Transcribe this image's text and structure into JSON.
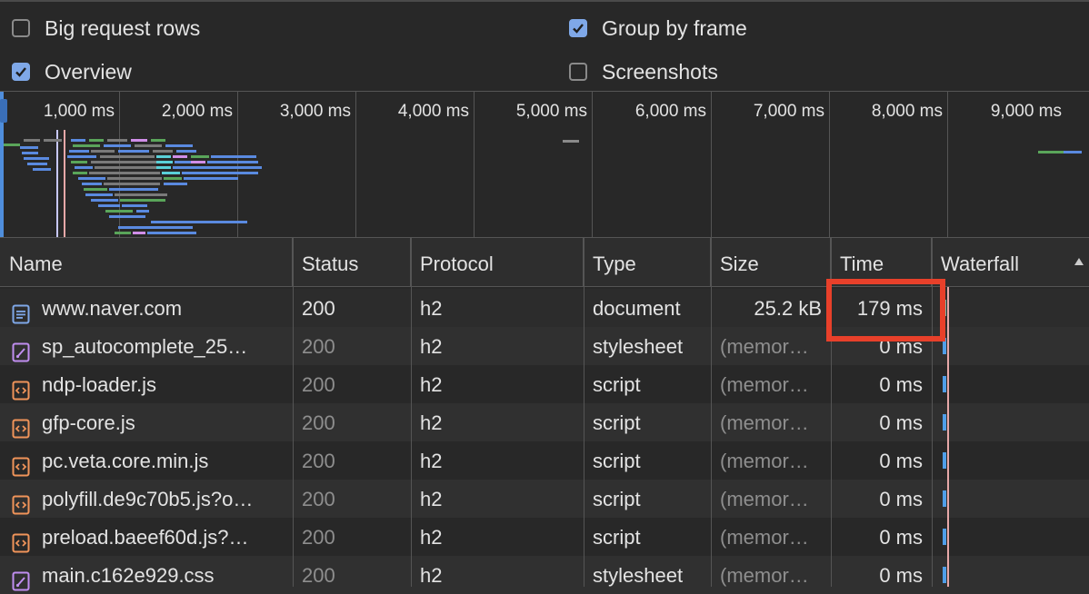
{
  "settings": {
    "big_request_rows": {
      "label": "Big request rows",
      "checked": false
    },
    "overview": {
      "label": "Overview",
      "checked": true
    },
    "group_by_frame": {
      "label": "Group by frame",
      "checked": true
    },
    "screenshots": {
      "label": "Screenshots",
      "checked": false
    }
  },
  "overview": {
    "ticks": [
      "1,000 ms",
      "2,000 ms",
      "3,000 ms",
      "4,000 ms",
      "5,000 ms",
      "6,000 ms",
      "7,000 ms",
      "8,000 ms",
      "9,000 ms"
    ]
  },
  "table": {
    "headers": {
      "name": "Name",
      "status": "Status",
      "protocol": "Protocol",
      "type": "Type",
      "size": "Size",
      "time": "Time",
      "waterfall": "Waterfall"
    },
    "rows": [
      {
        "icon": "document-icon",
        "name": "www.naver.com",
        "status": "200",
        "protocol": "h2",
        "type": "document",
        "size": "25.2 kB",
        "time": "179 ms"
      },
      {
        "icon": "stylesheet-icon",
        "name": "sp_autocomplete_25…",
        "status": "200",
        "protocol": "h2",
        "type": "stylesheet",
        "size": "(memor…",
        "time": "0 ms"
      },
      {
        "icon": "script-icon",
        "name": "ndp-loader.js",
        "status": "200",
        "protocol": "h2",
        "type": "script",
        "size": "(memor…",
        "time": "0 ms"
      },
      {
        "icon": "script-icon",
        "name": "gfp-core.js",
        "status": "200",
        "protocol": "h2",
        "type": "script",
        "size": "(memor…",
        "time": "0 ms"
      },
      {
        "icon": "script-icon",
        "name": "pc.veta.core.min.js",
        "status": "200",
        "protocol": "h2",
        "type": "script",
        "size": "(memor…",
        "time": "0 ms"
      },
      {
        "icon": "script-icon",
        "name": "polyfill.de9c70b5.js?o…",
        "status": "200",
        "protocol": "h2",
        "type": "script",
        "size": "(memor…",
        "time": "0 ms"
      },
      {
        "icon": "script-icon",
        "name": "preload.baeef60d.js?…",
        "status": "200",
        "protocol": "h2",
        "type": "script",
        "size": "(memor…",
        "time": "0 ms"
      },
      {
        "icon": "stylesheet-icon",
        "name": "main.c162e929.css",
        "status": "200",
        "protocol": "h2",
        "type": "stylesheet",
        "size": "(memor…",
        "time": "0 ms"
      }
    ]
  },
  "colors": {
    "accent": "#7fa8e8",
    "highlight_box": "#e8402a",
    "document_icon": "#7fa8e8",
    "stylesheet_icon": "#c08ef0",
    "script_icon": "#f0945a"
  }
}
